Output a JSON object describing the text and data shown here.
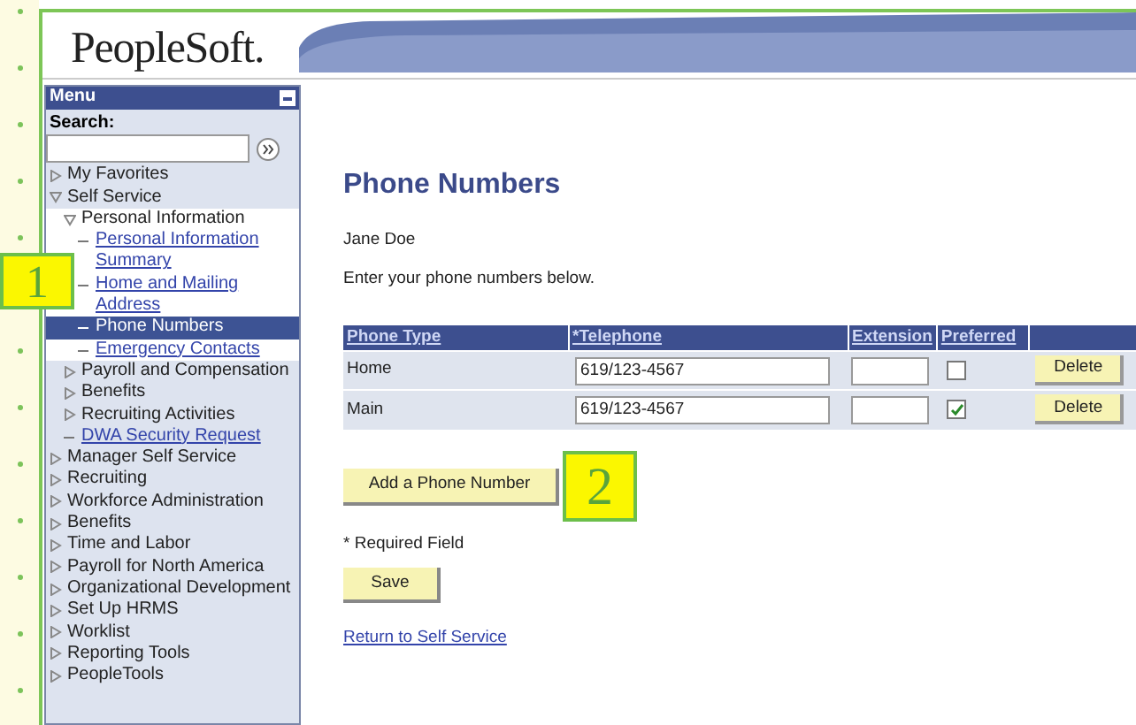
{
  "callouts": [
    {
      "label": "1",
      "kind": "menu"
    },
    {
      "label": "2",
      "kind": "button"
    }
  ],
  "logo": "PeopleSoft.",
  "menu": {
    "title": "Menu",
    "search_label": "Search:",
    "items": [
      {
        "label": "My Favorites",
        "kind": "folder",
        "expanded": false
      },
      {
        "label": "Self Service",
        "kind": "folder",
        "expanded": true,
        "children": [
          {
            "label": "Personal Information",
            "kind": "folder",
            "expanded": true,
            "children": [
              {
                "label": "Personal Information Summary",
                "kind": "link",
                "selected": false
              },
              {
                "label": "Home and Mailing Address",
                "kind": "link",
                "selected": false
              },
              {
                "label": "Phone Numbers",
                "kind": "link",
                "selected": true
              },
              {
                "label": "Emergency Contacts",
                "kind": "link",
                "selected": false
              }
            ]
          },
          {
            "label": "Payroll and Compensation",
            "kind": "folder",
            "expanded": false
          },
          {
            "label": "Benefits",
            "kind": "folder",
            "expanded": false
          },
          {
            "label": "Recruiting Activities",
            "kind": "folder",
            "expanded": false
          },
          {
            "label": "DWA Security Request",
            "kind": "link",
            "selected": false
          }
        ]
      },
      {
        "label": "Manager Self Service",
        "kind": "folder",
        "expanded": false
      },
      {
        "label": "Recruiting",
        "kind": "folder",
        "expanded": false
      },
      {
        "label": "Workforce Administration",
        "kind": "folder",
        "expanded": false
      },
      {
        "label": "Benefits",
        "kind": "folder",
        "expanded": false
      },
      {
        "label": "Time and Labor",
        "kind": "folder",
        "expanded": false
      },
      {
        "label": "Payroll for North America",
        "kind": "folder",
        "expanded": false
      },
      {
        "label": "Organizational Development",
        "kind": "folder",
        "expanded": false
      },
      {
        "label": "Set Up HRMS",
        "kind": "folder",
        "expanded": false
      },
      {
        "label": "Worklist",
        "kind": "folder",
        "expanded": false
      },
      {
        "label": "Reporting Tools",
        "kind": "folder",
        "expanded": false
      },
      {
        "label": "PeopleTools",
        "kind": "folder",
        "expanded": false
      }
    ]
  },
  "page": {
    "title": "Phone Numbers",
    "name": "Jane Doe",
    "instructions": "Enter your phone numbers below.",
    "table": {
      "columns": [
        "Phone Type",
        "*Telephone",
        "Extension",
        "Preferred"
      ],
      "rows": [
        {
          "phone_type": "Home",
          "telephone": "619/123-4567",
          "preferred": false,
          "action": "Delete"
        },
        {
          "phone_type": "Main",
          "telephone": "619/123-4567",
          "preferred": true,
          "action": "Delete"
        }
      ]
    },
    "add_button": "Add a Phone Number",
    "required_note": "* Required Field",
    "save_button": "Save",
    "return_link": "Return to Self Service"
  }
}
